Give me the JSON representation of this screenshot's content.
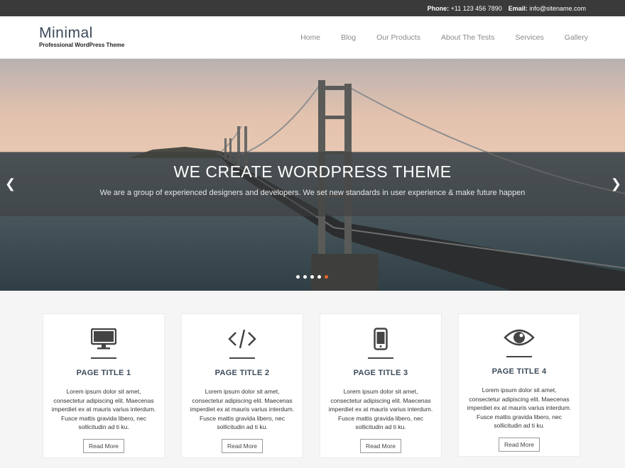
{
  "topbar": {
    "phone_label": "Phone:",
    "phone": "+11 123 456 7890",
    "email_label": "Email:",
    "email": "info@sitename.com"
  },
  "brand": {
    "title": "Minimal",
    "tagline": "Professional WordPress Theme"
  },
  "nav": [
    "Home",
    "Blog",
    "Our Products",
    "About The Tests",
    "Services",
    "Gallery"
  ],
  "slider": {
    "heading": "WE CREATE WORDPRESS THEME",
    "subheading": "We are a group of experienced designers and developers. We set new standards in user experience & make future happen",
    "prev_icon": "chevron-left-icon",
    "next_icon": "chevron-right-icon",
    "slide_count": 5,
    "active_slide": 5,
    "accent": "#e8652b"
  },
  "cards": [
    {
      "icon": "monitor-icon",
      "title": "PAGE TITLE 1",
      "body": "Lorem ipsum dolor sit amet, consectetur adipiscing elit. Maecenas imperdiet ex at mauris varius interdum. Fusce mattis gravida libero, nec sollicitudin ad ti ku.",
      "button": "Read More"
    },
    {
      "icon": "code-icon",
      "title": "PAGE TITLE 2",
      "body": "Lorem ipsum dolor sit amet, consectetur adipiscing elit. Maecenas imperdiet ex at mauris varius interdum. Fusce mattis gravida libero, nec sollicitudin ad ti ku.",
      "button": "Read More"
    },
    {
      "icon": "mobile-icon",
      "title": "PAGE TITLE 3",
      "body": "Lorem ipsum dolor sit amet, consectetur adipiscing elit. Maecenas imperdiet ex at mauris varius interdum. Fusce mattis gravida libero, nec sollicitudin ad ti ku.",
      "button": "Read More"
    },
    {
      "icon": "eye-icon",
      "title": "PAGE TITLE 4",
      "body": "Lorem ipsum dolor sit amet, consectetur adipiscing elit. Maecenas imperdiet ex at mauris varius interdum. Fusce mattis gravida libero, nec sollicitudin ad ti ku.",
      "button": "Read More"
    }
  ]
}
